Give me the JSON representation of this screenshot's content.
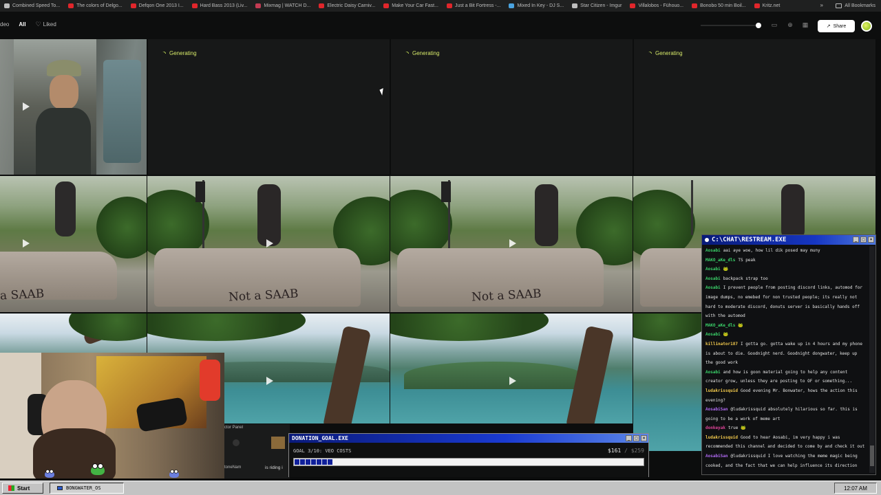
{
  "bookmarks": [
    {
      "label": "Combined Speed To...",
      "color": "#bdbdbd"
    },
    {
      "label": "The colors of Delgo...",
      "color": "#e0262b"
    },
    {
      "label": "Defqon One 2013 I...",
      "color": "#e0262b"
    },
    {
      "label": "Hard Bass 2013 (Liv...",
      "color": "#e0262b"
    },
    {
      "label": "Mixmag | WATCH D...",
      "color": "#c23b53"
    },
    {
      "label": "Electric Daisy Carniv...",
      "color": "#e0262b"
    },
    {
      "label": "Make Your Car Fast...",
      "color": "#e0262b"
    },
    {
      "label": "Just a Bit Fortress -...",
      "color": "#e0262b"
    },
    {
      "label": "Mixed In Key - DJ S...",
      "color": "#4aa3df"
    },
    {
      "label": "Star Citizen - Imgur",
      "color": "#bdbdbd"
    },
    {
      "label": "Villalobos - Fühouo...",
      "color": "#e0262b"
    },
    {
      "label": "Bonobo 50 min Boil...",
      "color": "#e0262b"
    },
    {
      "label": "Kritz.net",
      "color": "#e0262b"
    }
  ],
  "bookmarks_more": "»",
  "all_bookmarks": "All Bookmarks",
  "toolbar": {
    "left_cut": "deo",
    "all_label": "All",
    "liked_label": "Liked",
    "share_label": "Share"
  },
  "tiles": {
    "generating_label": "Generating",
    "car_text": "Not a SAAB",
    "car_text_cut": "a SAAB"
  },
  "webcam": {
    "actor_panel_title": "ctor Panel",
    "actor_name": "toneNam",
    "actor_message": "is riding i"
  },
  "donation": {
    "title": "DONATION_GOAL.EXE",
    "goal_text": "GOAL 3/10: VEO COSTS",
    "current": "$161",
    "separator": "/",
    "total": "$259",
    "progress_fraction": 0.11
  },
  "chat": {
    "title": "C:\\CHAT\\RESTREAM.EXE",
    "messages": [
      {
        "user": "Aosabi",
        "user_color": "#3bd46a",
        "text": "aai aye woe, how lil dik posed may muny"
      },
      {
        "user": "MAKO_aKe_dls",
        "user_color": "#3bd46a",
        "text": "TS peak"
      },
      {
        "user": "Aosabi",
        "user_color": "#3bd46a",
        "text": "🐸"
      },
      {
        "user": "Aosabi",
        "user_color": "#3bd46a",
        "text": "backpack strap too"
      },
      {
        "user": "Aosabi",
        "user_color": "#3bd46a",
        "text": "I prevent people from posting discord links, automod for image dumps, no emebed for non trusted people; its really not hard to moderate discord, donuts server is basically hands off with the automod"
      },
      {
        "user": "MAKO_aKe_dls",
        "user_color": "#3bd46a",
        "text": "🐸"
      },
      {
        "user": "Aosabi",
        "user_color": "#3bd46a",
        "text": "🐸"
      },
      {
        "user": "killinator187",
        "user_color": "#f2c94c",
        "text": "I gotta go. gotta wake up in 4 hours and my phone is about to die. Goodnight nerd. Goodnight dongwater, keep up the good work"
      },
      {
        "user": "Aosabi",
        "user_color": "#3bd46a",
        "text": "and how is goon material going to help any content creator grow, unless they are posting to OF or something..."
      },
      {
        "user": "ludakrissquid",
        "user_color": "#f2c94c",
        "text": "Good evening Mr. Bonwater, hows the action this evening?"
      },
      {
        "user": "AosabiSan",
        "user_color": "#b06af2",
        "text": "@ludakrissquid absolutely hilarious so far. this is going to be a work of meme art"
      },
      {
        "user": "donkeyak",
        "user_color": "#e0449a",
        "text": "true 🐸"
      },
      {
        "user": "ludakrissquid",
        "user_color": "#f2c94c",
        "text": "Good to hear Aosabi, im very happy i was recommended this channel and decided to come by and check it out"
      },
      {
        "user": "AosabiSan",
        "user_color": "#b06af2",
        "text": "@ludakrissquid I love watching the meme magic being cooked, and the fact that we can help influence its direction"
      }
    ]
  },
  "taskbar": {
    "start_label": "Start",
    "task_label": "BONGWATER_OS",
    "clock": "12:07 AM"
  }
}
